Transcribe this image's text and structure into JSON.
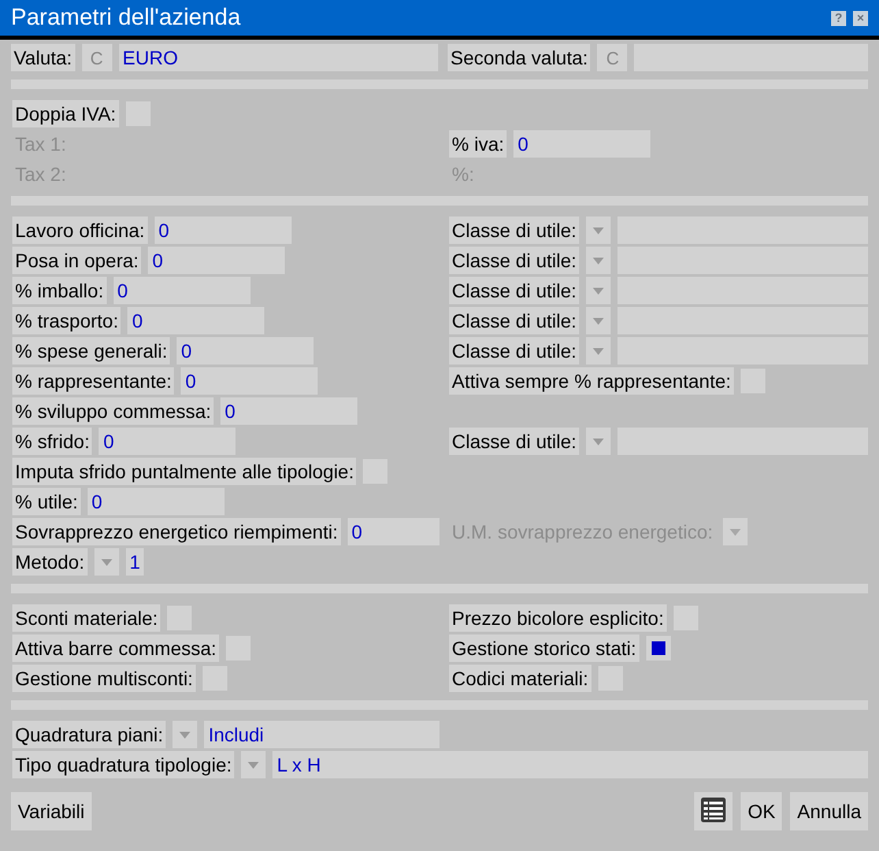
{
  "window": {
    "title": "Parametri dell'azienda",
    "title_buttons": [
      "?",
      "×"
    ]
  },
  "sections": [
    {
      "rows": [
        {
          "left": {
            "kind": "currency",
            "label": "Valuta:",
            "button": "C",
            "value": "EURO",
            "disabled": false
          },
          "right": {
            "kind": "currency",
            "label": "Seconda valuta:",
            "button": "C",
            "disabled": false
          }
        }
      ]
    },
    {
      "rows": [
        {
          "left": {
            "kind": "check",
            "label": "Doppia IVA:",
            "checked": false,
            "disabled": false
          }
        },
        {
          "left": {
            "kind": "text",
            "label": "Tax 1:",
            "disabled": true
          },
          "right": {
            "kind": "number",
            "label": "% iva:",
            "value": "0",
            "disabled": false
          }
        },
        {
          "left": {
            "kind": "text",
            "label": "Tax 2:",
            "disabled": true
          },
          "right": {
            "kind": "text",
            "label": "%:",
            "disabled": true
          }
        }
      ]
    },
    {
      "rows": [
        {
          "left": {
            "kind": "number",
            "label": "Lavoro officina:",
            "value": "0",
            "disabled": false
          },
          "right": {
            "kind": "combo-field",
            "label": "Classe di utile:",
            "disabled": false
          }
        },
        {
          "left": {
            "kind": "number",
            "label": "Posa in opera:",
            "value": "0",
            "disabled": false
          },
          "right": {
            "kind": "combo-field",
            "label": "Classe di utile:",
            "disabled": false
          }
        },
        {
          "left": {
            "kind": "number",
            "label": "% imballo:",
            "value": "0",
            "disabled": false
          },
          "right": {
            "kind": "combo-field",
            "label": "Classe di utile:",
            "disabled": false
          }
        },
        {
          "left": {
            "kind": "number",
            "label": "% trasporto:",
            "value": "0",
            "disabled": false
          },
          "right": {
            "kind": "combo-field",
            "label": "Classe di utile:",
            "disabled": false
          }
        },
        {
          "left": {
            "kind": "number",
            "label": "% spese generali:",
            "value": "0",
            "disabled": false
          },
          "right": {
            "kind": "combo-field",
            "label": "Classe di utile:",
            "disabled": false
          }
        },
        {
          "left": {
            "kind": "number",
            "label": "% rappresentante:",
            "value": "0",
            "disabled": false
          },
          "right": {
            "kind": "check",
            "label": "Attiva sempre % rappresentante:",
            "checked": false,
            "disabled": false
          }
        },
        {
          "left": {
            "kind": "number",
            "label": "% sviluppo commessa:",
            "value": "0",
            "disabled": false
          }
        },
        {
          "left": {
            "kind": "number",
            "label": "% sfrido:",
            "value": "0",
            "disabled": false
          },
          "right": {
            "kind": "combo-field",
            "label": "Classe di utile:",
            "disabled": false
          }
        },
        {
          "left": {
            "kind": "check",
            "label": "Imputa sfrido puntalmente alle tipologie:",
            "checked": false,
            "disabled": false
          }
        },
        {
          "left": {
            "kind": "number",
            "label": "% utile:",
            "value": "0",
            "disabled": false
          }
        },
        {
          "left": {
            "kind": "number",
            "label": "Sovrapprezzo energetico riempimenti:",
            "value": "0",
            "disabled": false
          },
          "right": {
            "kind": "combo",
            "label": "U.M. sovrapprezzo energetico:",
            "disabled": true
          }
        },
        {
          "left": {
            "kind": "combo-value",
            "label": "Metodo:",
            "value": "1",
            "disabled": false
          }
        }
      ]
    },
    {
      "rows": [
        {
          "left": {
            "kind": "check",
            "label": "Sconti materiale:",
            "checked": false,
            "disabled": false
          },
          "right": {
            "kind": "check",
            "label": "Prezzo bicolore esplicito:",
            "checked": false,
            "disabled": false
          }
        },
        {
          "left": {
            "kind": "check",
            "label": "Attiva barre commessa:",
            "checked": false,
            "disabled": false
          },
          "right": {
            "kind": "check",
            "label": "Gestione storico stati:",
            "checked": true,
            "disabled": false
          }
        },
        {
          "left": {
            "kind": "check",
            "label": "Gestione multisconti:",
            "checked": false,
            "disabled": false
          },
          "right": {
            "kind": "check",
            "label": "Codici materiali:",
            "checked": false,
            "disabled": false
          }
        }
      ]
    },
    {
      "rows": [
        {
          "left": {
            "kind": "combo-field",
            "label": "Quadratura piani:",
            "value": "Includi",
            "disabled": false
          }
        },
        {
          "left": {
            "kind": "combo-wide",
            "label": "Tipo quadratura tipologie:",
            "value": "L x H",
            "disabled": false
          }
        }
      ]
    }
  ],
  "footer_left": [
    {
      "kind": "text",
      "label": "Variabili"
    }
  ],
  "footer_right": [
    {
      "kind": "table"
    },
    {
      "kind": "text",
      "label": "OK"
    },
    {
      "kind": "text",
      "label": "Annulla"
    }
  ]
}
